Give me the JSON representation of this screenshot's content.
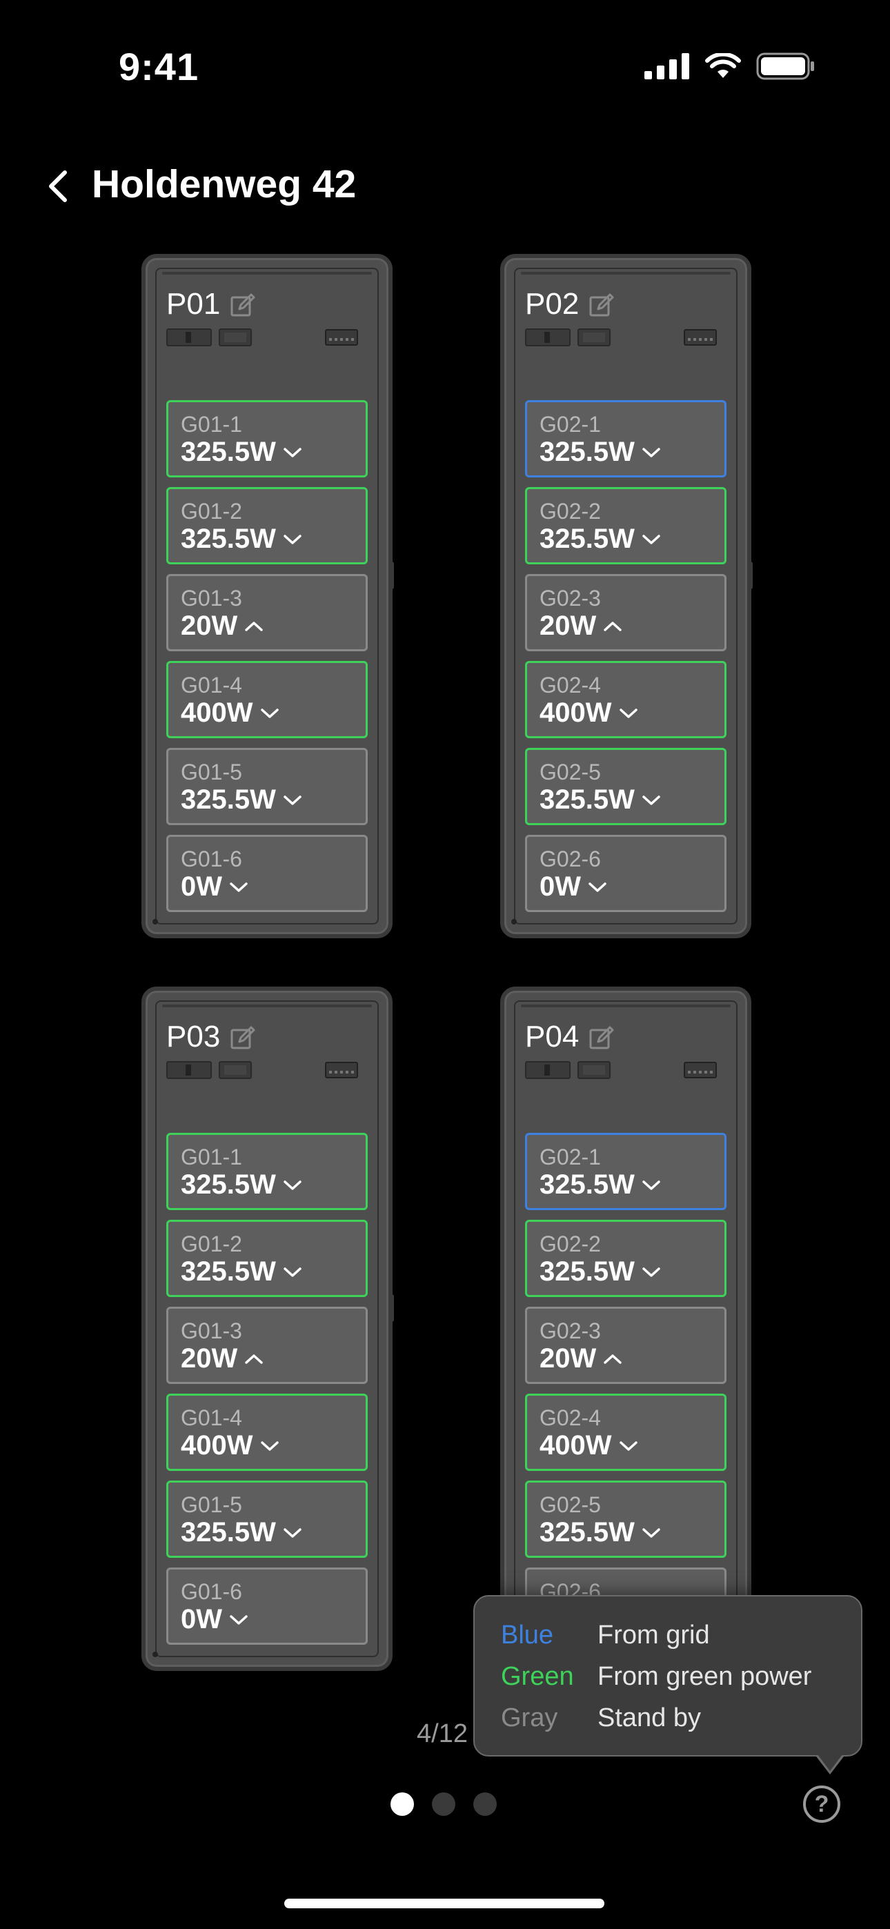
{
  "status_bar": {
    "time": "9:41"
  },
  "header": {
    "title": "Holdenweg 42"
  },
  "colors": {
    "green": "#3fd25a",
    "blue": "#3d82e0",
    "gray": "#8a8a8a",
    "background": "#000000"
  },
  "cabinets": [
    {
      "name": "P01",
      "slots": [
        {
          "id": "G01-1",
          "power": "325.5W",
          "status": "green",
          "chevron": "down"
        },
        {
          "id": "G01-2",
          "power": "325.5W",
          "status": "green",
          "chevron": "down"
        },
        {
          "id": "G01-3",
          "power": "20W",
          "status": "gray",
          "chevron": "up"
        },
        {
          "id": "G01-4",
          "power": "400W",
          "status": "green",
          "chevron": "down"
        },
        {
          "id": "G01-5",
          "power": "325.5W",
          "status": "gray",
          "chevron": "down"
        },
        {
          "id": "G01-6",
          "power": "0W",
          "status": "gray",
          "chevron": "down"
        }
      ]
    },
    {
      "name": "P02",
      "slots": [
        {
          "id": "G02-1",
          "power": "325.5W",
          "status": "blue",
          "chevron": "down"
        },
        {
          "id": "G02-2",
          "power": "325.5W",
          "status": "green",
          "chevron": "down"
        },
        {
          "id": "G02-3",
          "power": "20W",
          "status": "gray",
          "chevron": "up"
        },
        {
          "id": "G02-4",
          "power": "400W",
          "status": "green",
          "chevron": "down"
        },
        {
          "id": "G02-5",
          "power": "325.5W",
          "status": "green",
          "chevron": "down"
        },
        {
          "id": "G02-6",
          "power": "0W",
          "status": "gray",
          "chevron": "down"
        }
      ]
    },
    {
      "name": "P03",
      "slots": [
        {
          "id": "G01-1",
          "power": "325.5W",
          "status": "green",
          "chevron": "down"
        },
        {
          "id": "G01-2",
          "power": "325.5W",
          "status": "green",
          "chevron": "down"
        },
        {
          "id": "G01-3",
          "power": "20W",
          "status": "gray",
          "chevron": "up"
        },
        {
          "id": "G01-4",
          "power": "400W",
          "status": "green",
          "chevron": "down"
        },
        {
          "id": "G01-5",
          "power": "325.5W",
          "status": "green",
          "chevron": "down"
        },
        {
          "id": "G01-6",
          "power": "0W",
          "status": "gray",
          "chevron": "down"
        }
      ]
    },
    {
      "name": "P04",
      "slots": [
        {
          "id": "G02-1",
          "power": "325.5W",
          "status": "blue",
          "chevron": "down"
        },
        {
          "id": "G02-2",
          "power": "325.5W",
          "status": "green",
          "chevron": "down"
        },
        {
          "id": "G02-3",
          "power": "20W",
          "status": "gray",
          "chevron": "up"
        },
        {
          "id": "G02-4",
          "power": "400W",
          "status": "green",
          "chevron": "down"
        },
        {
          "id": "G02-5",
          "power": "325.5W",
          "status": "green",
          "chevron": "down"
        },
        {
          "id": "G02-6",
          "power": "",
          "status": "gray",
          "chevron": "none"
        }
      ]
    }
  ],
  "legend": {
    "items": [
      {
        "key": "Blue",
        "label": "From grid",
        "color": "#3d82e0"
      },
      {
        "key": "Green",
        "label": "From green power",
        "color": "#3fd25a"
      },
      {
        "key": "Gray",
        "label": "Stand by",
        "color": "#8a8a8a"
      }
    ]
  },
  "pager": {
    "counter": "4/12"
  }
}
